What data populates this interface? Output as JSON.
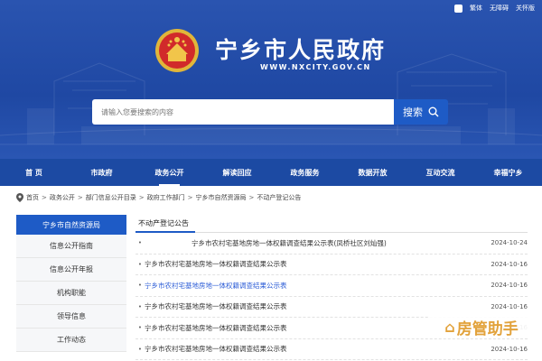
{
  "header": {
    "top_links": [
      "繁体",
      "无障碍",
      "关怀版"
    ],
    "site_title": "宁乡市人民政府",
    "site_url": "WWW.NXCITY.GOV.CN",
    "search_placeholder": "请输入您要搜索的内容",
    "search_button": "搜索"
  },
  "nav": [
    "首 页",
    "市政府",
    "政务公开",
    "解读回应",
    "政务服务",
    "数据开放",
    "互动交流",
    "幸福宁乡"
  ],
  "breadcrumb": [
    "首页",
    "政务公开",
    "部门信息公开目录",
    "政府工作部门",
    "宁乡市自然资源局",
    "不动产登记公告"
  ],
  "sidebar": {
    "title": "宁乡市自然资源局",
    "items": [
      "信息公开指南",
      "信息公开年报",
      "机构职能",
      "领导信息",
      "工作动态"
    ]
  },
  "main": {
    "section_title": "不动产登记公告",
    "rows": [
      {
        "title": "宁乡市农村宅基地房地一体权籍调查结果公示表(凤桥社区刘灿强)",
        "date": "2024-10-24"
      },
      {
        "title": "宁乡市农村宅基地房地一体权籍调查结果公示表",
        "date": "2024-10-16"
      },
      {
        "title": "宁乡市农村宅基地房地一体权籍调查结果公示表",
        "date": "2024-10-16"
      },
      {
        "title": "宁乡市农村宅基地房地一体权籍调查结果公示表",
        "date": "2024-10-16"
      },
      {
        "title": "宁乡市农村宅基地房地一体权籍调查结果公示表",
        "date": "2024-10-16"
      },
      {
        "title": "宁乡市农村宅基地房地一体权籍调查结果公示表",
        "date": "2024-10-16"
      }
    ]
  },
  "watermark": "房管助手",
  "colors": {
    "primary": "#1e5bc6",
    "nav": "#1c4aa3",
    "header": "#2a54b0",
    "link": "#2a5bd6",
    "watermark": "#e2a23b"
  }
}
